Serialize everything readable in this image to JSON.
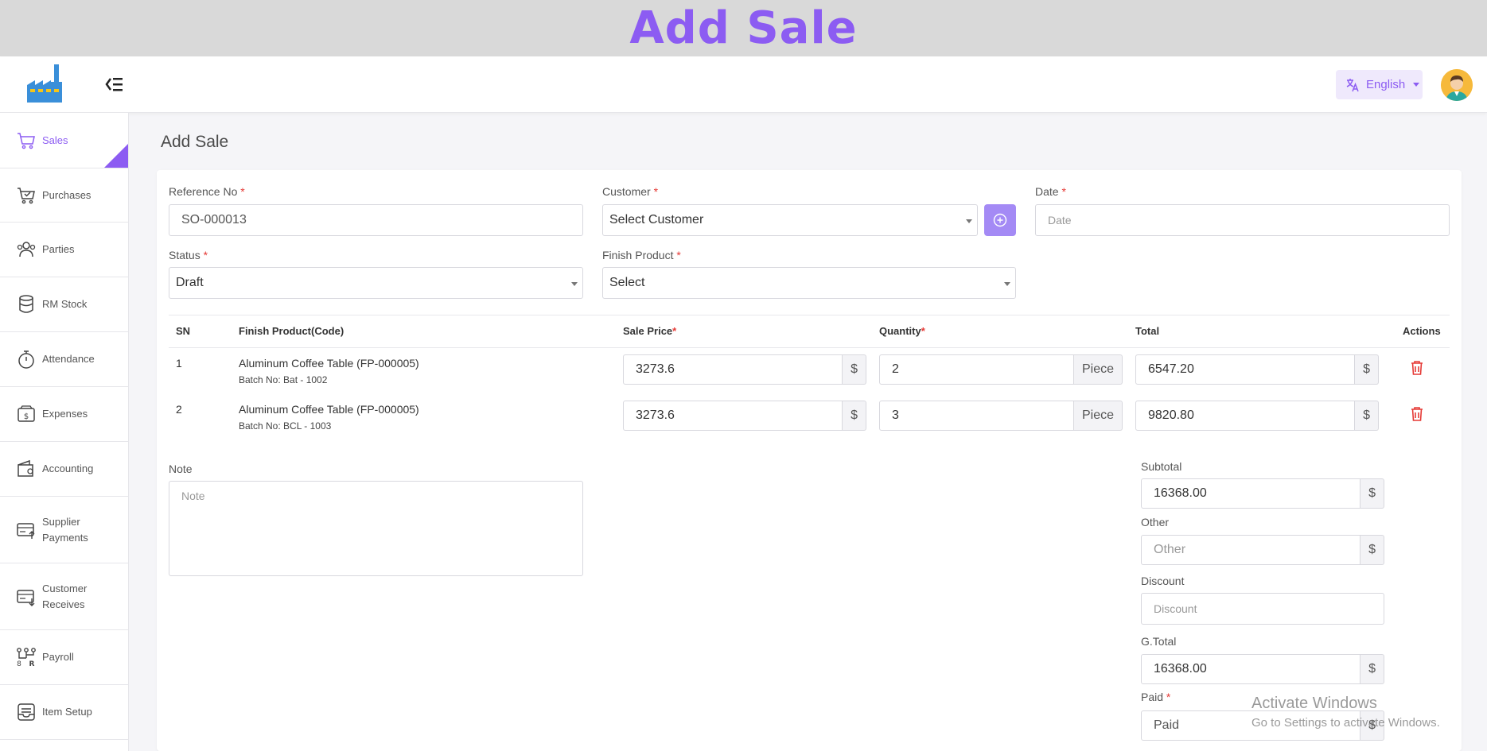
{
  "banner": {
    "title": "Add Sale"
  },
  "topbar": {
    "language": "English"
  },
  "sidebar": {
    "items": [
      {
        "label": "Sales",
        "icon": "cart-icon"
      },
      {
        "label": "Purchases",
        "icon": "purchase-cart-icon"
      },
      {
        "label": "Parties",
        "icon": "users-icon"
      },
      {
        "label": "RM Stock",
        "icon": "database-icon"
      },
      {
        "label": "Attendance",
        "icon": "stopwatch-icon"
      },
      {
        "label": "Expenses",
        "icon": "dollar-note-icon"
      },
      {
        "label": "Accounting",
        "icon": "wallet-icon"
      },
      {
        "label": "Supplier Payments",
        "icon": "payment-out-icon"
      },
      {
        "label": "Customer Receives",
        "icon": "payment-in-icon"
      },
      {
        "label": "Payroll",
        "icon": "payroll-icon"
      },
      {
        "label": "Item Setup",
        "icon": "inbox-icon"
      }
    ]
  },
  "page": {
    "title": "Add Sale"
  },
  "form": {
    "reference": {
      "label": "Reference No",
      "value": "SO-000013"
    },
    "customer": {
      "label": "Customer",
      "value": "Select Customer"
    },
    "date": {
      "label": "Date",
      "placeholder": "Date"
    },
    "status": {
      "label": "Status",
      "value": "Draft"
    },
    "finish_product": {
      "label": "Finish Product",
      "value": "Select"
    },
    "required_mark": "*"
  },
  "table": {
    "headers": {
      "sn": "SN",
      "product": "Finish Product(Code)",
      "sale_price": "Sale Price",
      "quantity": "Quantity",
      "total": "Total",
      "actions": "Actions"
    },
    "rows": [
      {
        "sn": "1",
        "product": "Aluminum Coffee Table (FP-000005)",
        "batch": "Batch No: Bat - 1002",
        "price": "3273.6",
        "price_unit": "$",
        "qty": "2",
        "qty_unit": "Piece",
        "total": "6547.20",
        "total_unit": "$"
      },
      {
        "sn": "2",
        "product": "Aluminum Coffee Table (FP-000005)",
        "batch": "Batch No: BCL - 1003",
        "price": "3273.6",
        "price_unit": "$",
        "qty": "3",
        "qty_unit": "Piece",
        "total": "9820.80",
        "total_unit": "$"
      }
    ]
  },
  "note": {
    "label": "Note",
    "placeholder": "Note"
  },
  "summary": {
    "subtotal": {
      "label": "Subtotal",
      "value": "16368.00",
      "unit": "$"
    },
    "other": {
      "label": "Other",
      "placeholder": "Other",
      "unit": "$"
    },
    "discount": {
      "label": "Discount",
      "placeholder": "Discount"
    },
    "gtotal": {
      "label": "G.Total",
      "value": "16368.00",
      "unit": "$"
    },
    "paid": {
      "label": "Paid",
      "placeholder": "Paid",
      "unit": "$"
    }
  },
  "watermark": {
    "line1": "Activate Windows",
    "line2": "Go to Settings to activate Windows."
  },
  "colors": {
    "accent": "#8c5cf2",
    "danger": "#e53935",
    "banner_bg": "#d9d9d9"
  }
}
